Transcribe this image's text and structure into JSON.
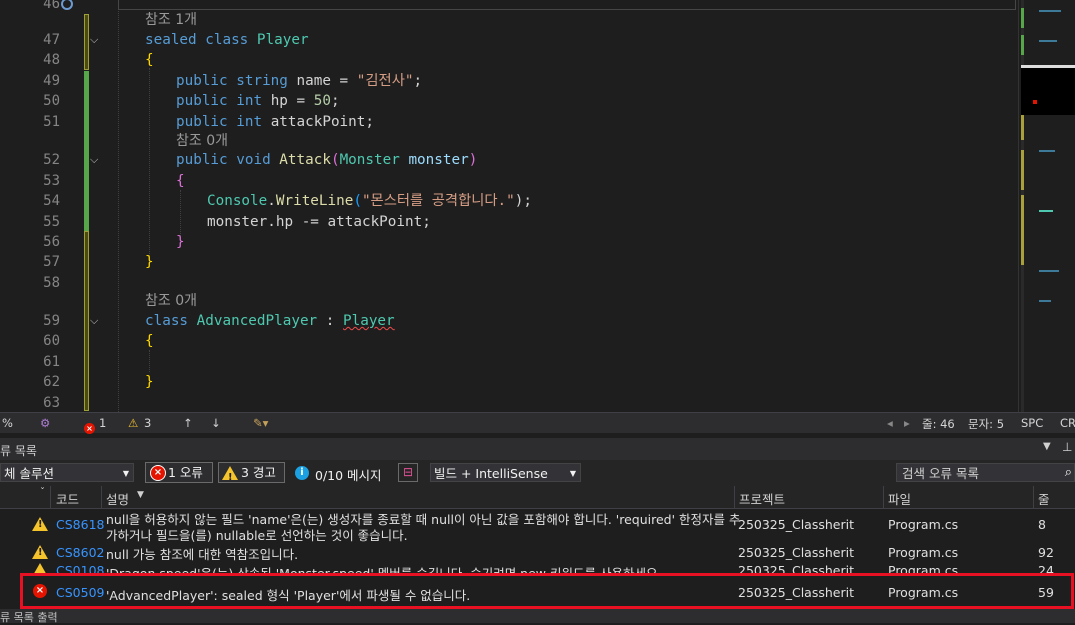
{
  "editor": {
    "line_numbers": [
      "46",
      "47",
      "48",
      "49",
      "50",
      "51",
      "52",
      "53",
      "54",
      "55",
      "56",
      "57",
      "58",
      "59",
      "60",
      "61",
      "62",
      "63"
    ],
    "refs": {
      "r47": "참조 1개",
      "r52": "참조 0개",
      "r59": "참조 0개"
    },
    "code": {
      "l47_kw": "sealed class",
      "l47_ty": "Player",
      "l48": "{",
      "l49_kw": "public string",
      "l49_id": "name",
      "l49_op": " = ",
      "l49_str": "\"김전사\"",
      "l49_end": ";",
      "l50_kw": "public int",
      "l50_id": "hp",
      "l50_op": " = ",
      "l50_num": "50",
      "l50_end": ";",
      "l51_kw": "public int",
      "l51_id": "attackPoint",
      "l51_end": ";",
      "l52_kw": "public void",
      "l52_fn": "Attack",
      "l52_p1": "(",
      "l52_ty": "Monster",
      "l52_id": "monster",
      "l52_p2": ")",
      "l53": "{",
      "l54_ty": "Console",
      "l54_dot": ".",
      "l54_fn": "WriteLine",
      "l54_p1": "(",
      "l54_str": "\"몬스터를 공격합니다.\"",
      "l54_end": ");",
      "l55_id": "monster",
      "l55_rest": ".hp -= ",
      "l55_id2": "attackPoint",
      "l55_end": ";",
      "l56": "}",
      "l57": "}",
      "l59_kw": "class",
      "l59_ty": "AdvancedPlayer",
      "l59_colon": " : ",
      "l59_base": "Player",
      "l60": "{",
      "l62": "}"
    }
  },
  "editor_status": {
    "zoom": "%",
    "errors": "1",
    "warnings": "3",
    "line": "줄: 46",
    "char": "문자: 5",
    "spc": "SPC",
    "crlf": "CR"
  },
  "error_list": {
    "title": "류 목록",
    "scope": "체 솔루션",
    "errors_chip": "1 오류",
    "warnings_chip": "3 경고",
    "messages": "0/10 메시지",
    "build_filter": "빌드 + IntelliSense",
    "search_placeholder": "검색 오류 목록",
    "columns": {
      "code": "코드",
      "desc": "설명",
      "project": "프로젝트",
      "file": "파일",
      "line": "줄"
    },
    "rows": [
      {
        "type": "warning",
        "code": "CS8618",
        "desc1": "null을 허용하지 않는 필드 'name'은(는) 생성자를 종료할 때 null이 아닌 값을 포함해야 합니다. 'required' 한정자를 추",
        "desc2": "가하거나 필드을(를) nullable로 선언하는 것이 좋습니다.",
        "project": "250325_Classherit",
        "file": "Program.cs",
        "line": "8"
      },
      {
        "type": "warning",
        "code": "CS8602",
        "desc1": "null 가능 참조에 대한 역참조입니다.",
        "project": "250325_Classherit",
        "file": "Program.cs",
        "line": "92"
      },
      {
        "type": "warning",
        "code": "CS0108",
        "desc1": "'Dragon.speed'은(는) 상속된 'Monster.speed' 멤버를 숨깁니다. 숨기려면 new 키워드를 사용하세요.",
        "project": "250325_Classherit",
        "file": "Program.cs",
        "line": "24"
      },
      {
        "type": "error",
        "code": "CS0509",
        "desc1": "'AdvancedPlayer': sealed 형식 'Player'에서 파생될 수 없습니다.",
        "project": "250325_Classherit",
        "file": "Program.cs",
        "line": "59"
      }
    ]
  },
  "bottom_tabs": {
    "label": "류 목록 출력"
  },
  "colors": {
    "highlight_border": "#e81123",
    "error": "#e51400",
    "warning": "#f5c32c",
    "link": "#3794ff"
  }
}
